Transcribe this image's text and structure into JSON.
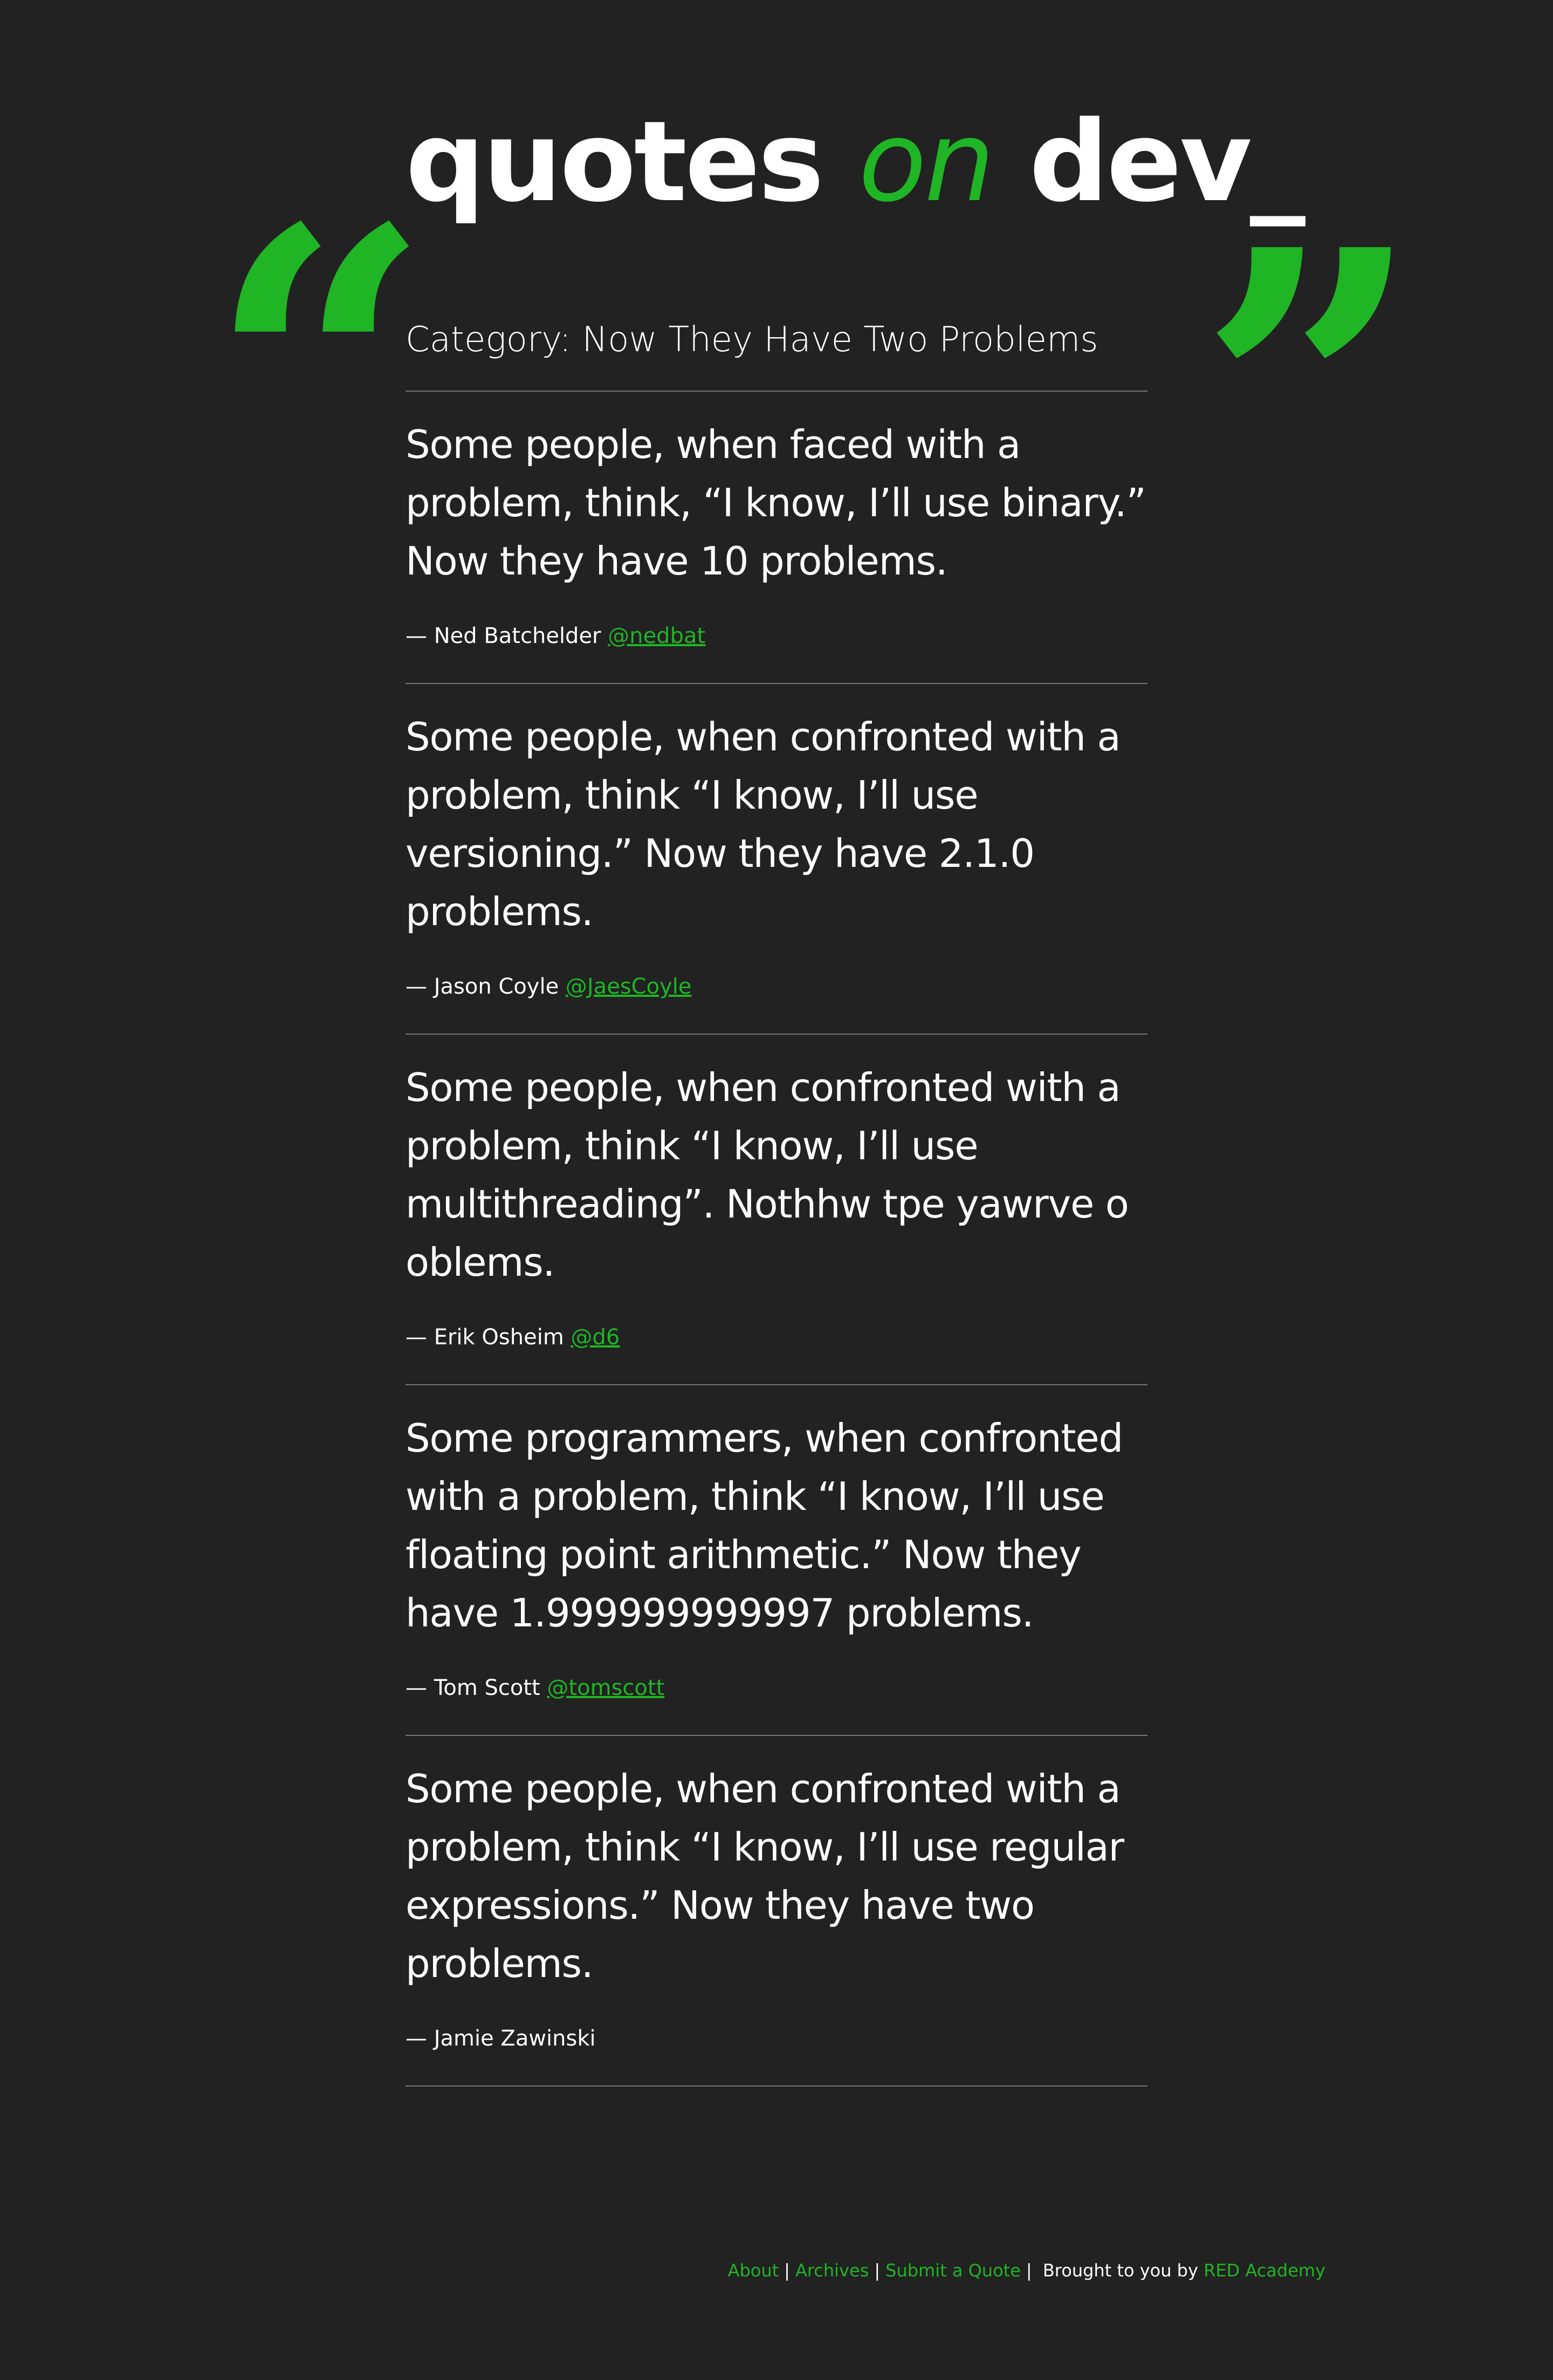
{
  "site": {
    "logo_main": "quotes ",
    "logo_on": "on",
    "logo_dev": " dev_",
    "accent_color": "#1fb525",
    "background_color": "#222222",
    "open_quote_glyph": "“",
    "close_quote_glyph": "”"
  },
  "page": {
    "category_title": "Category: Now They Have Two Problems"
  },
  "quotes": [
    {
      "text": "Some people, when faced with a problem, think, “I know, I’ll use binary.” Now they have 10 problems.",
      "author": "— Ned Batchelder",
      "handle": "@nedbat"
    },
    {
      "text": "Some people, when confronted with a problem, think “I know, I’ll use versioning.” Now they have 2.1.0 problems.",
      "author": "— Jason Coyle",
      "handle": "@JaesCoyle"
    },
    {
      "text": "Some people, when confronted with a problem, think “I know, I’ll use multithreading”. Nothhw tpe yawrve o oblems.",
      "author": "— Erik Osheim",
      "handle": "@d6"
    },
    {
      "text": "Some programmers, when confronted with a problem, think “I know, I’ll use floating point arithmetic.” Now they have 1.999999999997 problems.",
      "author": "— Tom Scott",
      "handle": "@tomscott"
    },
    {
      "text": "Some people, when confronted with a problem, think “I know, I’ll use regular expressions.” Now they have two problems.",
      "author": "— Jamie Zawinski",
      "handle": ""
    }
  ],
  "footer": {
    "nav": [
      "About",
      "Archives",
      "Submit a Quote"
    ],
    "separator": "|",
    "credit_text": "Brought to you by ",
    "credit_link": "RED Academy"
  }
}
